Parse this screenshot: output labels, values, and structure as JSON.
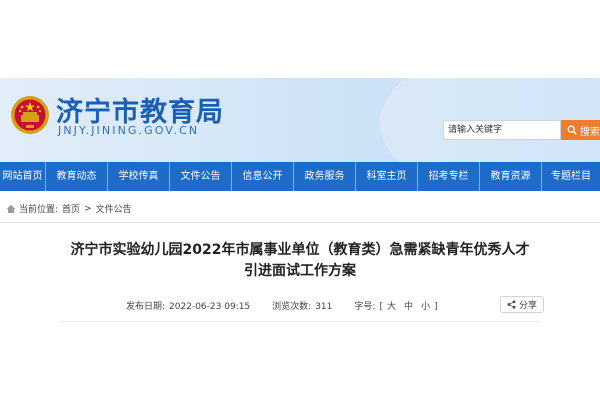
{
  "header": {
    "site_title": "济宁市教育局",
    "site_domain": "JNJY.JINING.GOV.CN",
    "search_placeholder": "请输入关键字",
    "search_button": "搜索"
  },
  "nav": {
    "items": [
      {
        "label": "网站首页"
      },
      {
        "label": "教育动态"
      },
      {
        "label": "学校传真"
      },
      {
        "label": "文件公告"
      },
      {
        "label": "信息公开"
      },
      {
        "label": "政务服务"
      },
      {
        "label": "科室主页"
      },
      {
        "label": "招考专栏"
      },
      {
        "label": "教育资源"
      },
      {
        "label": "专题栏目"
      }
    ]
  },
  "breadcrumb": {
    "prefix": "当前位置:",
    "home": "首页",
    "separator": ">",
    "current": "文件公告"
  },
  "article": {
    "title_line1": "济宁市实验幼儿园2022年市属事业单位（教育类）急需紧缺青年优秀人才",
    "title_line2": "引进面试工作方案",
    "publish_label": "发布日期:",
    "publish_date": "2022-06-23 09:15",
    "views_label": "浏览次数:",
    "views": "311",
    "font_label": "字号:",
    "font_open": "[",
    "font_large": "大",
    "font_medium": "中",
    "font_small": "小",
    "font_close": "]",
    "share_label": "分享"
  },
  "colors": {
    "nav_bg": "#1e6cc8",
    "brand_blue": "#1a5fb4",
    "search_button": "#f07c2e"
  }
}
